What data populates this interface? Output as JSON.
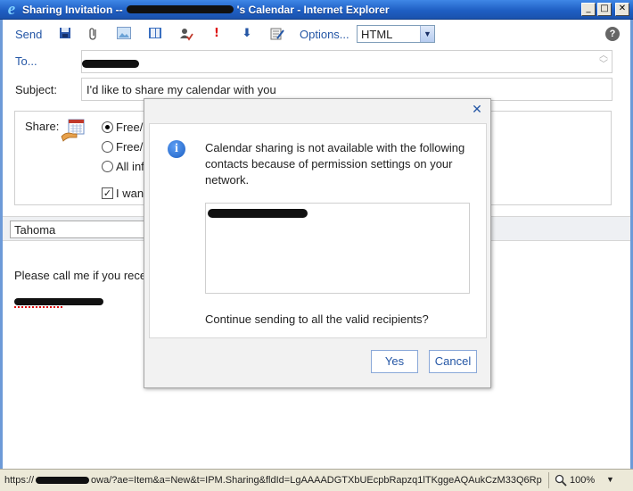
{
  "window": {
    "title_prefix": "Sharing Invitation --",
    "title_suffix": "'s Calendar - Internet Explorer",
    "title_color": "#1f5fc4"
  },
  "toolbar": {
    "send_label": "Send",
    "options_label": "Options...",
    "format_value": "HTML",
    "help_label": "?",
    "icons": [
      "save-icon",
      "attach-icon",
      "insert-image-icon",
      "address-book-icon",
      "check-names-icon",
      "high-importance-icon",
      "low-importance-icon",
      "spell-check-icon"
    ]
  },
  "compose": {
    "to_label": "To...",
    "subject_label": "Subject:",
    "subject_value": "I'd like to share my calendar with you"
  },
  "share": {
    "label": "Share:",
    "options": [
      {
        "label": "Free/b",
        "selected": true
      },
      {
        "label": "Free/b",
        "selected": false
      },
      {
        "label": "All inf",
        "selected": false
      }
    ],
    "checkbox_label": "I want",
    "checkbox_checked": true
  },
  "format_bar": {
    "font_value": "Tahoma"
  },
  "message": {
    "body_text": "Please call me if you rece"
  },
  "dialog": {
    "message": "Calendar sharing is not available with the following contacts because of permission settings on your network.",
    "question": "Continue sending to all the valid recipients?",
    "yes_label": "Yes",
    "cancel_label": "Cancel",
    "close_label": "✕",
    "accent_color": "#2456a5"
  },
  "status": {
    "url_start": "https://",
    "url_rest": "owa/?ae=Item&a=New&t=IPM.Sharing&fldId=LgAAAADGTXbUEcpbRapzq1lTKggeAQAukCzM33Q6Rp",
    "zoom": "100%"
  }
}
